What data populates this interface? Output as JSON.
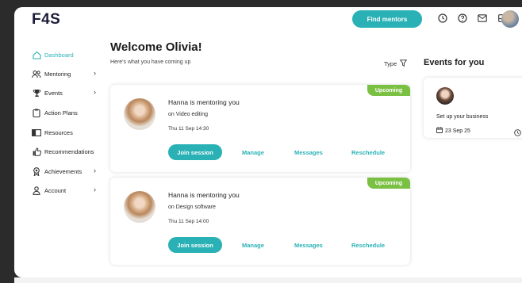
{
  "header": {
    "logo": "F4S",
    "find_mentors": "Find mentors",
    "icons": [
      "clock-icon",
      "help-icon",
      "mail-icon",
      "inbox-icon",
      "avatar"
    ]
  },
  "sidebar": {
    "items": [
      {
        "label": "Dashboard",
        "icon": "home-icon",
        "active": true,
        "chevron": false
      },
      {
        "label": "Mentoring",
        "icon": "people-icon",
        "active": false,
        "chevron": true
      },
      {
        "label": "Events",
        "icon": "trophy-icon",
        "active": false,
        "chevron": true
      },
      {
        "label": "Action Plans",
        "icon": "clipboard-icon",
        "active": false,
        "chevron": false
      },
      {
        "label": "Resources",
        "icon": "book-icon",
        "active": false,
        "chevron": false
      },
      {
        "label": "Recommendations",
        "icon": "thumbs-up-icon",
        "active": false,
        "chevron": false
      },
      {
        "label": "Achievements",
        "icon": "award-icon",
        "active": false,
        "chevron": true
      },
      {
        "label": "Account",
        "icon": "user-icon",
        "active": false,
        "chevron": true
      }
    ]
  },
  "main": {
    "welcome": "Welcome Olivia!",
    "subtitle": "Here's what you have coming up",
    "type_filter": "Type",
    "sessions": [
      {
        "badge": "Upcoming",
        "title": "Hanna is mentoring you",
        "topic": "on Video editing",
        "time": "Thu 11 Sep 14:30",
        "join": "Join session",
        "manage": "Manage",
        "messages": "Messages",
        "reschedule": "Reschedule"
      },
      {
        "badge": "Upcoming",
        "title": "Hanna is mentoring you",
        "topic": "on Design software",
        "time": "Thu 11 Sep 14:00",
        "join": "Join session",
        "manage": "Manage",
        "messages": "Messages",
        "reschedule": "Reschedule"
      }
    ]
  },
  "events": {
    "title": "Events for you",
    "items": [
      {
        "title": "Set up your business",
        "date": "23 Sep 25"
      }
    ]
  },
  "colors": {
    "accent": "#2ab1b5",
    "badge": "#7ac043"
  }
}
